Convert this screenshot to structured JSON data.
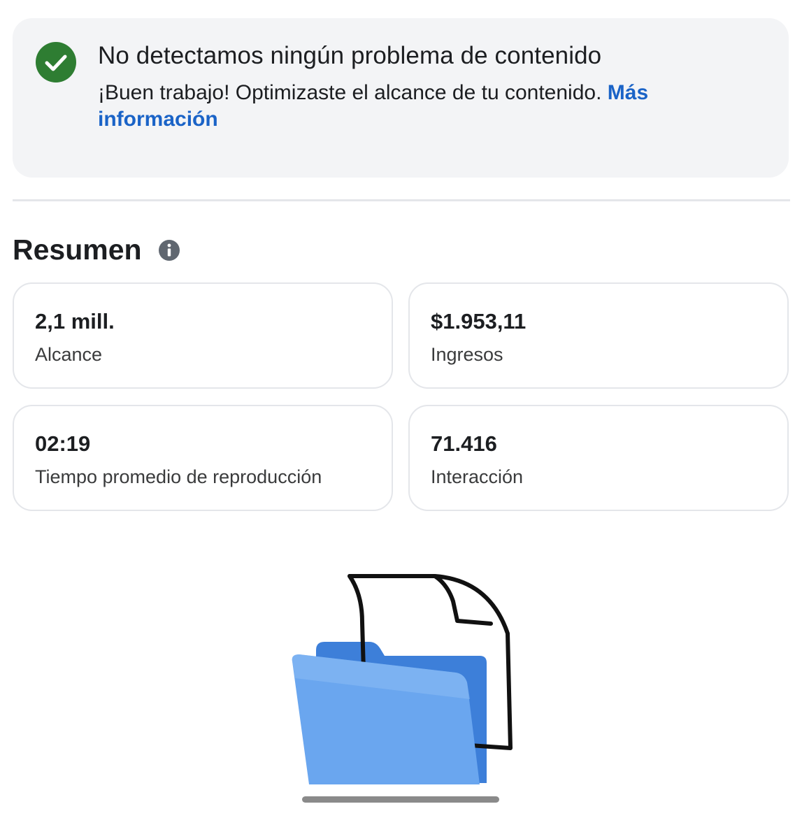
{
  "status_banner": {
    "title": "No detectamos ningún problema de contenido",
    "body": "¡Buen trabajo! Optimizaste el alcance de tu contenido.",
    "link_label": "Más información",
    "icon": "check-circle-icon",
    "colors": {
      "check": "#2e7d32",
      "link": "#1a63c7",
      "banner_bg": "#f3f4f6"
    }
  },
  "summary": {
    "title": "Resumen",
    "info_icon": "info-icon",
    "metrics": [
      {
        "value": "2,1 mill.",
        "label": "Alcance"
      },
      {
        "value": "$1.953,11",
        "label": "Ingresos"
      },
      {
        "value": "02:19",
        "label": "Tiempo promedio de reproducción"
      },
      {
        "value": "71.416",
        "label": "Interacción"
      }
    ]
  },
  "illustration": {
    "icon": "folder-with-document-icon",
    "folder_color": "#5b9be8"
  }
}
